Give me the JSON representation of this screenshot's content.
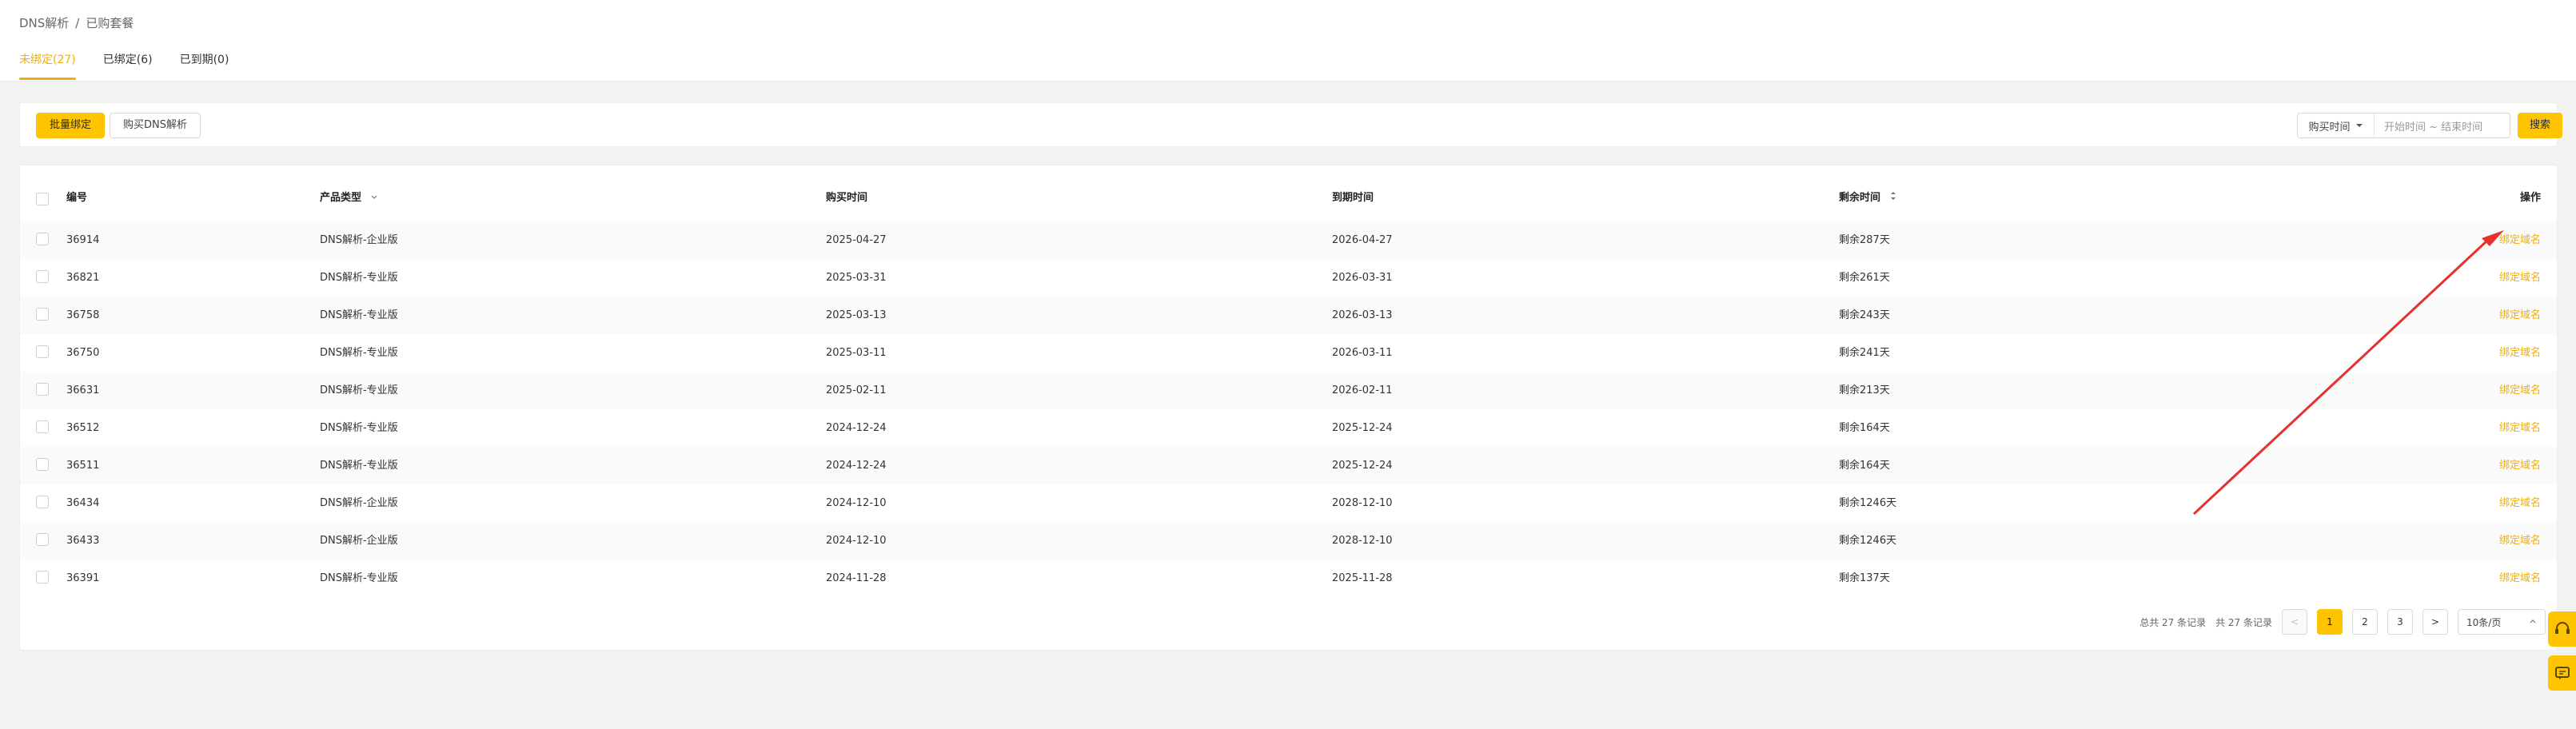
{
  "breadcrumb": {
    "root": "DNS解析",
    "sep": "/",
    "current": "已购套餐"
  },
  "tabs": [
    {
      "label": "未绑定(27)",
      "active": true
    },
    {
      "label": "已绑定(6)",
      "active": false
    },
    {
      "label": "已到期(0)",
      "active": false
    }
  ],
  "toolbar": {
    "bulk_bind": "批量绑定",
    "buy_dns": "购买DNS解析",
    "range_type": "购买时间",
    "range_placeholder": "开始时间 ~ 结束时间",
    "search": "搜索"
  },
  "table": {
    "headers": [
      "编号",
      "产品类型",
      "购买时间",
      "到期时间",
      "剩余时间",
      "操作"
    ],
    "rows": [
      {
        "id": "36914",
        "type": "DNS解析-企业版",
        "buy": "2025-04-27",
        "expire": "2026-04-27",
        "remain": "剩余287天",
        "action": "绑定域名"
      },
      {
        "id": "36821",
        "type": "DNS解析-专业版",
        "buy": "2025-03-31",
        "expire": "2026-03-31",
        "remain": "剩余261天",
        "action": "绑定域名"
      },
      {
        "id": "36758",
        "type": "DNS解析-专业版",
        "buy": "2025-03-13",
        "expire": "2026-03-13",
        "remain": "剩余243天",
        "action": "绑定域名"
      },
      {
        "id": "36750",
        "type": "DNS解析-专业版",
        "buy": "2025-03-11",
        "expire": "2026-03-11",
        "remain": "剩余241天",
        "action": "绑定域名"
      },
      {
        "id": "36631",
        "type": "DNS解析-专业版",
        "buy": "2025-02-11",
        "expire": "2026-02-11",
        "remain": "剩余213天",
        "action": "绑定域名"
      },
      {
        "id": "36512",
        "type": "DNS解析-专业版",
        "buy": "2024-12-24",
        "expire": "2025-12-24",
        "remain": "剩余164天",
        "action": "绑定域名"
      },
      {
        "id": "36511",
        "type": "DNS解析-专业版",
        "buy": "2024-12-24",
        "expire": "2025-12-24",
        "remain": "剩余164天",
        "action": "绑定域名"
      },
      {
        "id": "36434",
        "type": "DNS解析-企业版",
        "buy": "2024-12-10",
        "expire": "2028-12-10",
        "remain": "剩余1246天",
        "action": "绑定域名"
      },
      {
        "id": "36433",
        "type": "DNS解析-企业版",
        "buy": "2024-12-10",
        "expire": "2028-12-10",
        "remain": "剩余1246天",
        "action": "绑定域名"
      },
      {
        "id": "36391",
        "type": "DNS解析-专业版",
        "buy": "2024-11-28",
        "expire": "2025-11-28",
        "remain": "剩余137天",
        "action": "绑定域名"
      }
    ]
  },
  "pagination": {
    "total_text": "总共 27 条记录",
    "count_text": "共 27 条记录",
    "prev": "<",
    "next": ">",
    "pages": [
      "1",
      "2",
      "3"
    ],
    "current_page": "1",
    "page_size": "10条/页"
  },
  "colors": {
    "accent": "#ffc400",
    "link": "#f1ae0b",
    "annotation_arrow": "#e5322d"
  }
}
